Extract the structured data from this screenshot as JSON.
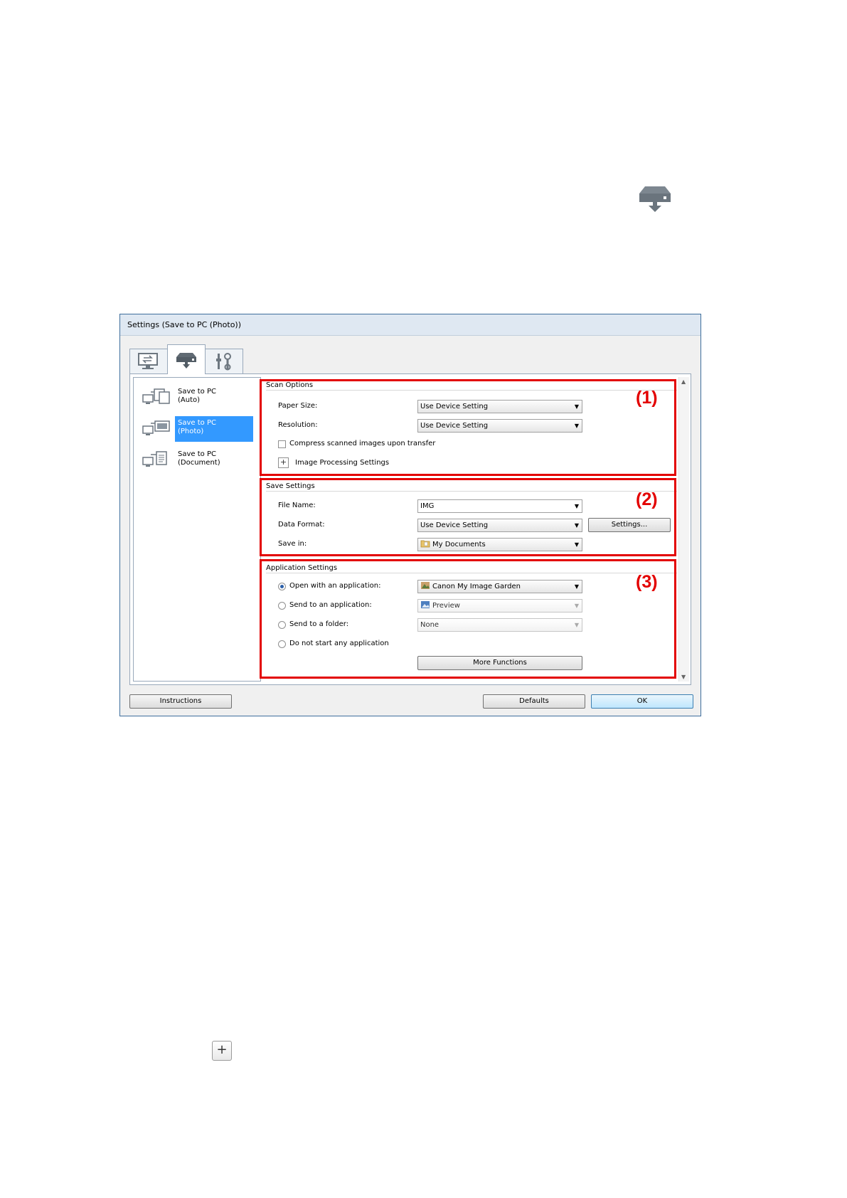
{
  "dialog": {
    "title": "Settings (Save to PC (Photo))",
    "tabs": [
      {
        "icon": "scan-from-computer-icon"
      },
      {
        "icon": "scan-from-operation-panel-icon"
      },
      {
        "icon": "general-settings-icon"
      }
    ],
    "side_items": [
      {
        "label": "Save to PC\n(Auto)"
      },
      {
        "label": "Save to PC\n(Photo)"
      },
      {
        "label": "Save to PC\n(Document)"
      }
    ],
    "scan_options": {
      "title": "Scan Options",
      "paper_size_label": "Paper Size:",
      "paper_size_value": "Use Device Setting",
      "resolution_label": "Resolution:",
      "resolution_value": "Use Device Setting",
      "compress_label": "Compress scanned images upon transfer",
      "image_processing_label": "Image Processing Settings",
      "callout": "(1)"
    },
    "save_settings": {
      "title": "Save Settings",
      "file_name_label": "File Name:",
      "file_name_value": "IMG",
      "data_format_label": "Data Format:",
      "data_format_value": "Use Device Setting",
      "settings_button": "Settings...",
      "save_in_label": "Save in:",
      "save_in_value": "My Documents",
      "callout": "(2)"
    },
    "application_settings": {
      "title": "Application Settings",
      "open_with_label": "Open with an application:",
      "open_with_value": "Canon My Image Garden",
      "send_to_app_label": "Send to an application:",
      "send_to_app_value": "Preview",
      "send_to_folder_label": "Send to a folder:",
      "send_to_folder_value": "None",
      "do_not_start_label": "Do not start any application",
      "more_functions_button": "More Functions",
      "callout": "(3)"
    },
    "footer": {
      "instructions": "Instructions",
      "defaults": "Defaults",
      "ok": "OK"
    }
  },
  "page_plus_icon": "plus-icon",
  "accent": "#3399ff",
  "callout_color": "#e30000"
}
